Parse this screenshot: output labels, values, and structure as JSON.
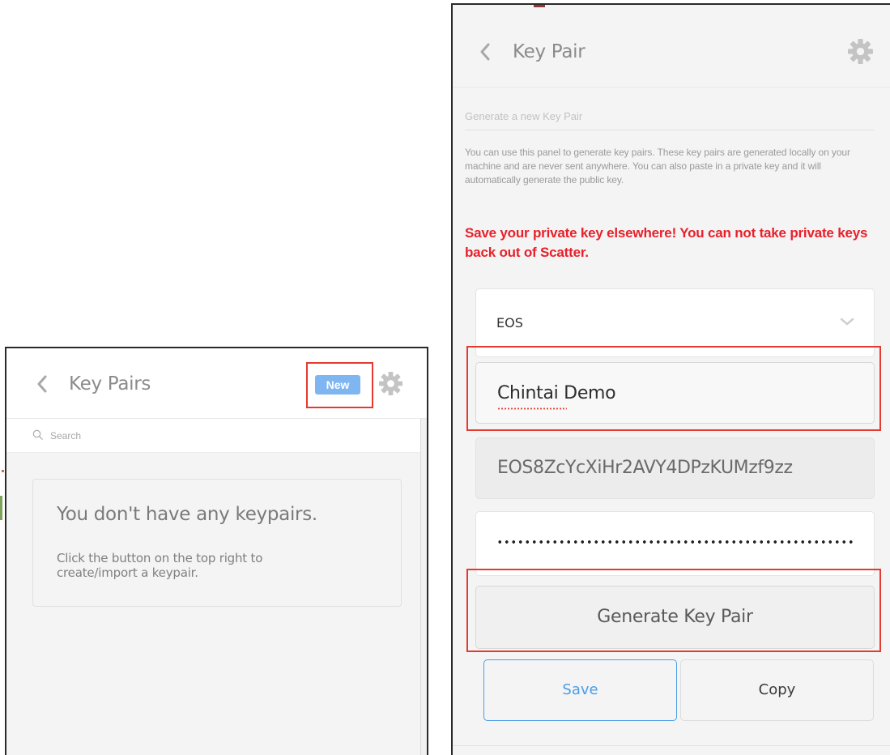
{
  "left_panel": {
    "title": "Key Pairs",
    "new_button_label": "New",
    "search": {
      "placeholder": "Search",
      "value": ""
    },
    "empty_state": {
      "title": "You don't have any keypairs.",
      "text": "Click the button on the top right to create/import a keypair."
    }
  },
  "right_panel": {
    "title": "Key Pair",
    "section_label": "Generate a new Key Pair",
    "description": "You can use this panel to generate key pairs. These key pairs are generated locally on your machine and are never sent anywhere. You can also paste in a private key and it will automatically generate the public key.",
    "warning": "Save your private key elsewhere! You can not take private keys back out of Scatter.",
    "blockchain_select": {
      "value": "EOS"
    },
    "name_field": {
      "value": "Chintai Demo"
    },
    "public_key": {
      "value": "EOS8ZcYcXiHr2AVY4DPzKUMzf9zz"
    },
    "private_key": {
      "masked": true
    },
    "generate_button_label": "Generate Key Pair",
    "save_button_label": "Save",
    "copy_button_label": "Copy"
  },
  "colors": {
    "highlight": "#e53a2f",
    "warning_text": "#e8202a",
    "new_button_bg": "#7fb6f2",
    "save_button_accent": "#4a9de6"
  },
  "icons": [
    "chevron-left-icon",
    "gear-icon",
    "search-icon",
    "chevron-down-icon"
  ]
}
